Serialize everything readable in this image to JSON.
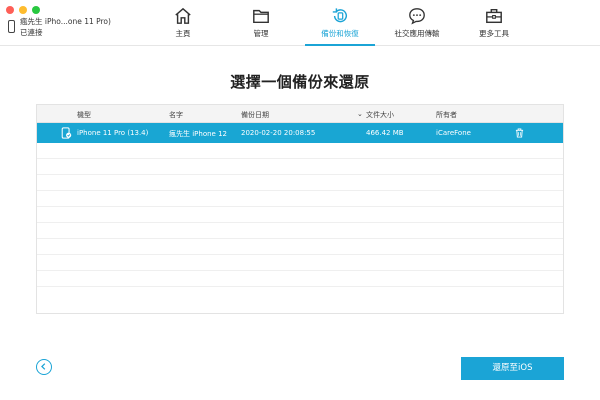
{
  "device": {
    "name": "瘋先生 iPho...one  11 Pro)",
    "status": "已連接"
  },
  "nav": {
    "home": "主頁",
    "manage": "管理",
    "backup_restore": "備份和恢復",
    "social": "社交應用傳輸",
    "more_tools": "更多工具"
  },
  "heading": "選擇一個備份來還原",
  "table": {
    "columns": {
      "model": "機型",
      "name": "名字",
      "date": "備份日期",
      "size": "文件大小",
      "owner": "所有者"
    },
    "sort_indicator": "⌄",
    "rows": [
      {
        "model": "iPhone  11 Pro (13.4)",
        "name": "瘋先生 iPhone 12",
        "date": "2020-02-20 20:08:55",
        "size": "466.42 MB",
        "owner": "iCareFone"
      }
    ]
  },
  "footer": {
    "restore_button": "還原至iOS"
  },
  "colors": {
    "accent": "#1ba4d6",
    "selected_row": "#19a6d3"
  }
}
